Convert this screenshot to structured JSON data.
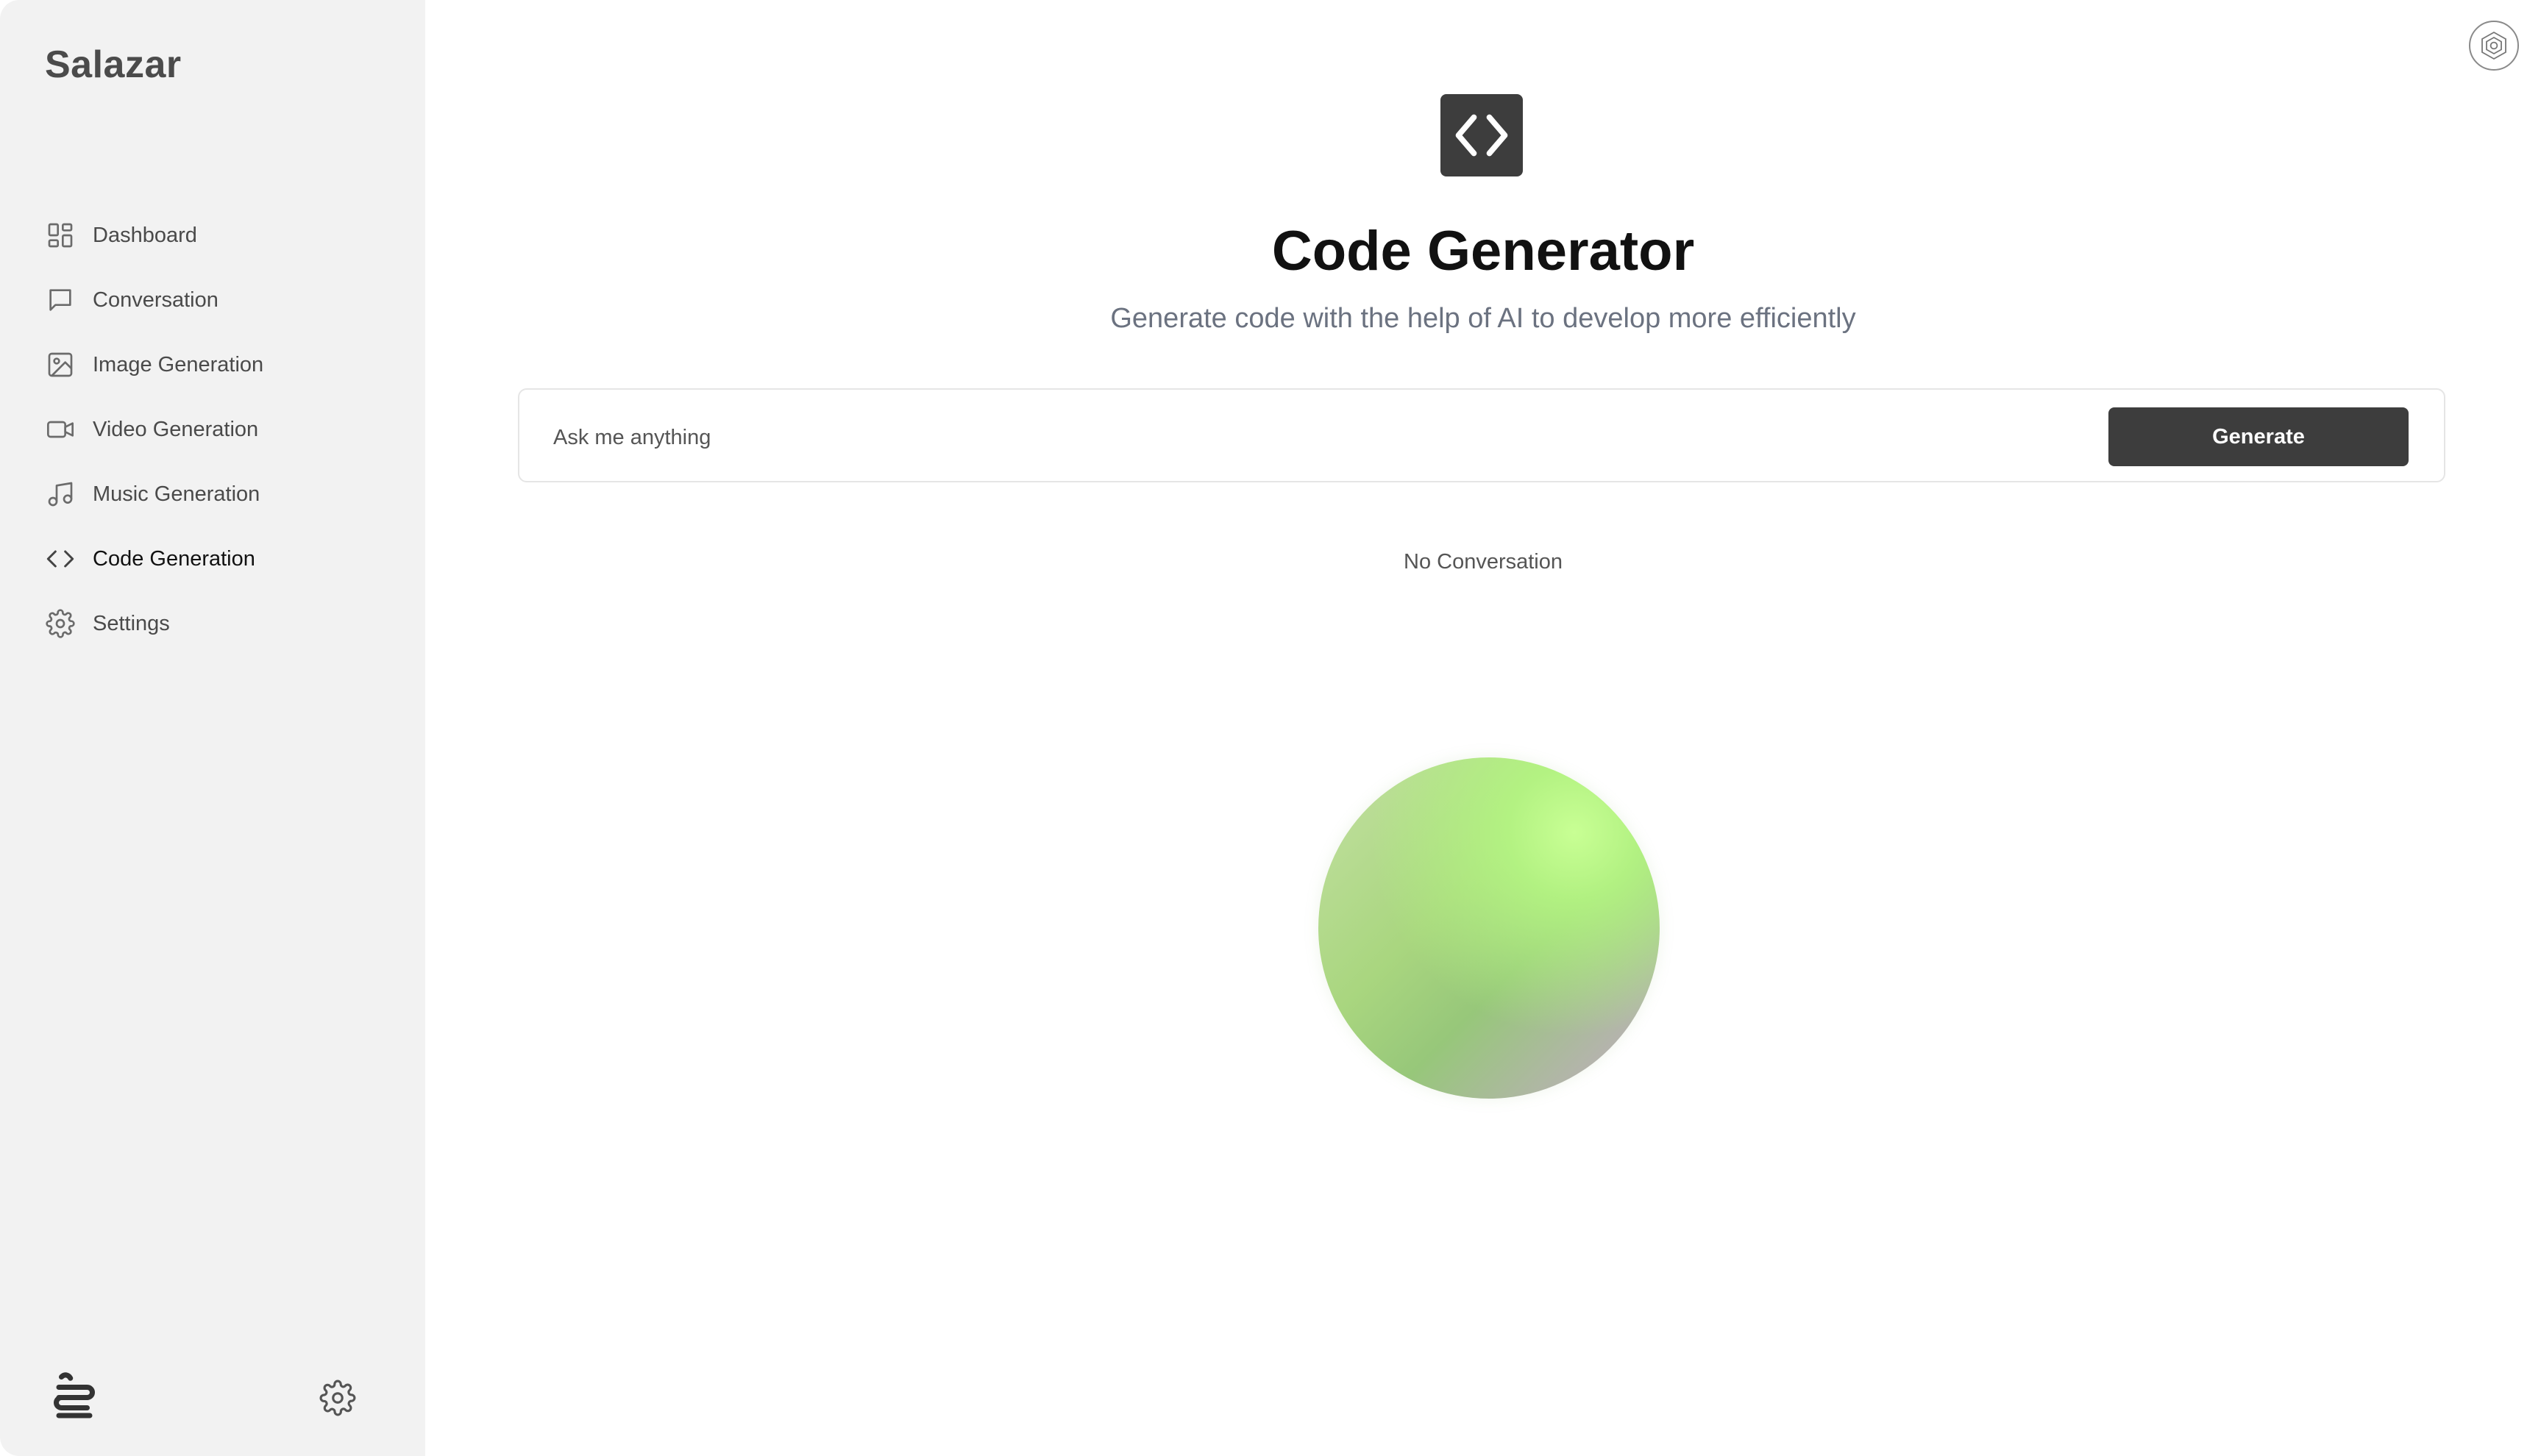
{
  "app": {
    "brand": "Salazar"
  },
  "sidebar": {
    "items": [
      {
        "label": "Dashboard",
        "icon": "dashboard-icon"
      },
      {
        "label": "Conversation",
        "icon": "chat-icon"
      },
      {
        "label": "Image Generation",
        "icon": "image-icon"
      },
      {
        "label": "Video Generation",
        "icon": "video-icon"
      },
      {
        "label": "Music Generation",
        "icon": "music-icon"
      },
      {
        "label": "Code Generation",
        "icon": "code-icon",
        "active": true
      },
      {
        "label": "Settings",
        "icon": "gear-icon"
      }
    ],
    "footer": {
      "logo_icon": "app-logo-icon",
      "settings_icon": "gear-icon"
    }
  },
  "main": {
    "hero_icon": "code-icon",
    "title": "Code Generator",
    "subtitle": "Generate code with the help of AI to develop more efficiently",
    "prompt": {
      "placeholder": "Ask me anything",
      "value": ""
    },
    "generate_label": "Generate",
    "empty_state": "No Conversation"
  },
  "colors": {
    "sidebar_bg": "#f2f2f2",
    "accent_dark": "#3d3d3d",
    "orb_green": "#b4f582"
  }
}
